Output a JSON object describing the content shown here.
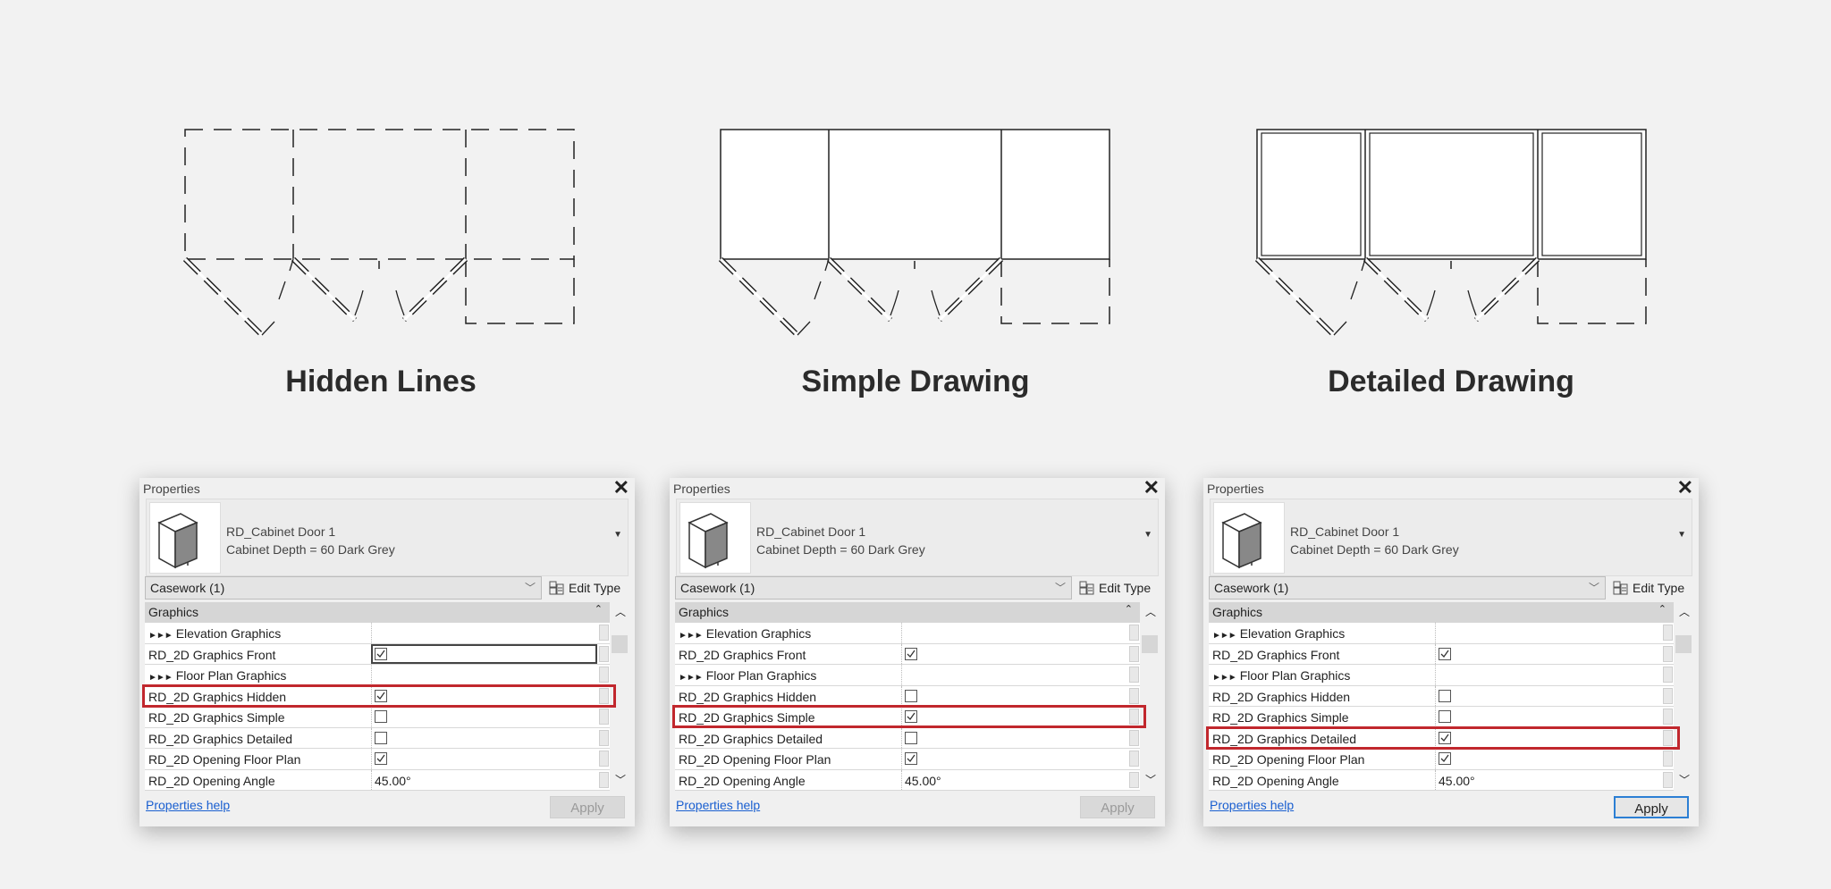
{
  "drawings": [
    {
      "title": "Hidden Lines",
      "style": "hidden"
    },
    {
      "title": "Simple Drawing",
      "style": "simple"
    },
    {
      "title": "Detailed Drawing",
      "style": "detailed"
    }
  ],
  "highlight_color": "#c1272d",
  "panels": [
    {
      "title": "Properties",
      "close_icon": "close-icon",
      "type_name": "RD_Cabinet Door 1",
      "type_detail": "Cabinet Depth = 60 Dark Grey",
      "selector": "Casework (1)",
      "edit_type": "Edit Type",
      "group": "Graphics",
      "rows": [
        {
          "label": "Elevation Graphics",
          "kind": "header"
        },
        {
          "label": "RD_2D Graphics Front",
          "kind": "check",
          "checked": true,
          "focused": true
        },
        {
          "label": "Floor Plan Graphics",
          "kind": "header"
        },
        {
          "label": "RD_2D Graphics Hidden",
          "kind": "check",
          "checked": true
        },
        {
          "label": "RD_2D Graphics Simple",
          "kind": "check",
          "checked": false
        },
        {
          "label": "RD_2D Graphics Detailed",
          "kind": "check",
          "checked": false
        },
        {
          "label": "RD_2D Opening Floor Plan",
          "kind": "check",
          "checked": true
        },
        {
          "label": "RD_2D Opening Angle",
          "kind": "text",
          "value": "45.00°"
        }
      ],
      "highlighted_row": 3,
      "help": "Properties help",
      "apply": "Apply",
      "apply_enabled": false
    },
    {
      "title": "Properties",
      "close_icon": "close-icon",
      "type_name": "RD_Cabinet Door 1",
      "type_detail": "Cabinet Depth = 60 Dark Grey",
      "selector": "Casework (1)",
      "edit_type": "Edit Type",
      "group": "Graphics",
      "rows": [
        {
          "label": "Elevation Graphics",
          "kind": "header"
        },
        {
          "label": "RD_2D Graphics Front",
          "kind": "check",
          "checked": true
        },
        {
          "label": "Floor Plan Graphics",
          "kind": "header"
        },
        {
          "label": "RD_2D Graphics Hidden",
          "kind": "check",
          "checked": false
        },
        {
          "label": "RD_2D Graphics Simple",
          "kind": "check",
          "checked": true
        },
        {
          "label": "RD_2D Graphics Detailed",
          "kind": "check",
          "checked": false
        },
        {
          "label": "RD_2D Opening Floor Plan",
          "kind": "check",
          "checked": true
        },
        {
          "label": "RD_2D Opening Angle",
          "kind": "text",
          "value": "45.00°"
        }
      ],
      "highlighted_row": 4,
      "help": "Properties help",
      "apply": "Apply",
      "apply_enabled": false
    },
    {
      "title": "Properties",
      "close_icon": "close-icon",
      "type_name": "RD_Cabinet Door 1",
      "type_detail": "Cabinet Depth = 60 Dark Grey",
      "selector": "Casework (1)",
      "edit_type": "Edit Type",
      "group": "Graphics",
      "rows": [
        {
          "label": "Elevation Graphics",
          "kind": "header"
        },
        {
          "label": "RD_2D Graphics Front",
          "kind": "check",
          "checked": true
        },
        {
          "label": "Floor Plan Graphics",
          "kind": "header"
        },
        {
          "label": "RD_2D Graphics Hidden",
          "kind": "check",
          "checked": false
        },
        {
          "label": "RD_2D Graphics Simple",
          "kind": "check",
          "checked": false
        },
        {
          "label": "RD_2D Graphics Detailed",
          "kind": "check",
          "checked": true
        },
        {
          "label": "RD_2D Opening Floor Plan",
          "kind": "check",
          "checked": true
        },
        {
          "label": "RD_2D Opening Angle",
          "kind": "text",
          "value": "45.00°"
        }
      ],
      "highlighted_row": 5,
      "help": "Properties help",
      "apply": "Apply",
      "apply_enabled": true
    }
  ]
}
